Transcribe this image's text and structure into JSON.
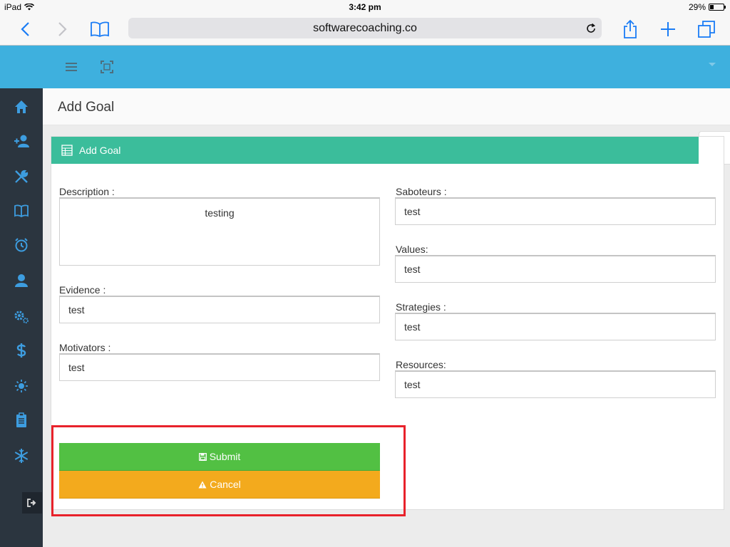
{
  "status_bar": {
    "device": "iPad",
    "time": "3:42 pm",
    "battery": "29%",
    "battery_level": 0.29
  },
  "browser": {
    "url": "softwarecoaching.co",
    "icons": [
      "back-icon",
      "forward-icon",
      "bookmarks-icon",
      "reload-icon",
      "share-icon",
      "new-tab-icon",
      "tabs-icon"
    ]
  },
  "header": {
    "icons": [
      "menu-icon",
      "fullscreen-icon",
      "dropdown-caret-icon"
    ],
    "color": "#3eb0de"
  },
  "sidebar": {
    "items": [
      {
        "name": "home-icon"
      },
      {
        "name": "add-user-icon"
      },
      {
        "name": "tools-icon"
      },
      {
        "name": "book-icon"
      },
      {
        "name": "alarm-icon"
      },
      {
        "name": "user-icon"
      },
      {
        "name": "cogs-icon"
      },
      {
        "name": "dollar-icon"
      },
      {
        "name": "sun-icon"
      },
      {
        "name": "clipboard-icon"
      },
      {
        "name": "snowflake-icon"
      }
    ],
    "logout_icon": "logout-icon"
  },
  "page": {
    "title": "Add Goal"
  },
  "panel": {
    "title": "Add Goal",
    "header_color": "#3bbd9b"
  },
  "form": {
    "description": {
      "label": "Description :",
      "value": "testing"
    },
    "evidence": {
      "label": "Evidence :",
      "value": "test"
    },
    "motivators": {
      "label": "Motivators :",
      "value": "test"
    },
    "saboteurs": {
      "label": "Saboteurs :",
      "value": "test"
    },
    "values": {
      "label": "Values:",
      "value": "test"
    },
    "strategies": {
      "label": "Strategies :",
      "value": "test"
    },
    "resources": {
      "label": "Resources:",
      "value": "test"
    }
  },
  "actions": {
    "submit_label": "Submit",
    "cancel_label": "Cancel",
    "submit_color": "#52c043",
    "cancel_color": "#f3aa1d"
  }
}
